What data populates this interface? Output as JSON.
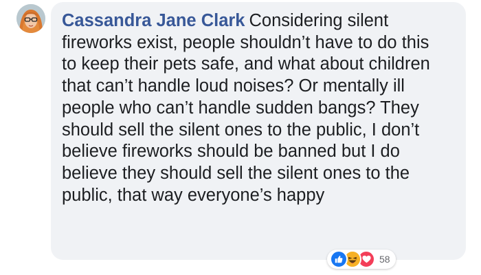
{
  "comment": {
    "author": "Cassandra Jane Clark",
    "text": "Considering silent fireworks exist, people shouldn’t have to do this to keep their pets safe, and what about children that can’t handle loud noises? Or mentally ill people who can’t handle sudden bangs? They should sell the silent ones to the public, I don’t believe fireworks should be banned but I do believe they should sell the silent ones to the public, that way everyone’s happy"
  },
  "reactions": {
    "icons": [
      "like-icon",
      "haha-icon",
      "love-icon"
    ],
    "count": "58"
  },
  "colors": {
    "author": "#385898",
    "bubble": "#f0f2f5",
    "like": "#1877f2",
    "haha": "#f7b125",
    "love": "#f33e58"
  }
}
